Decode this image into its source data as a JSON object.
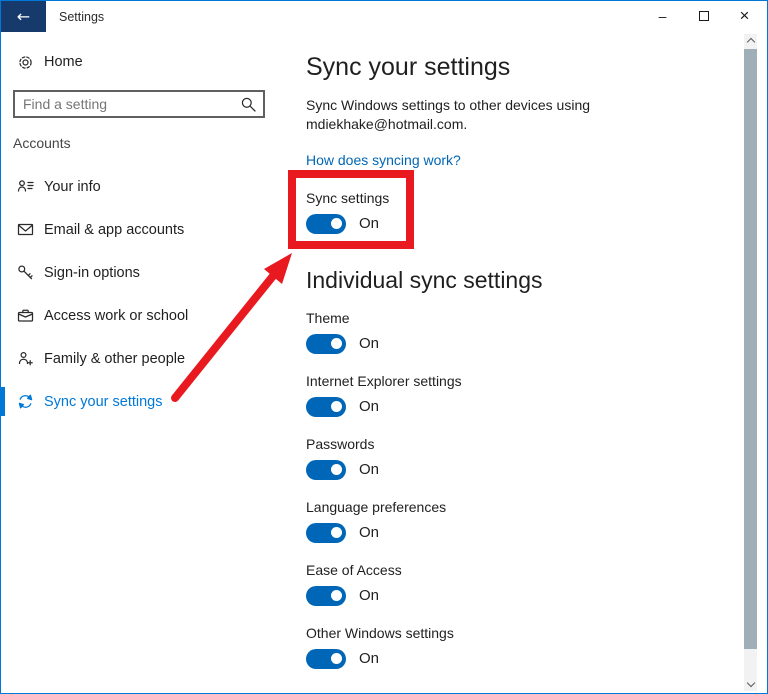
{
  "window": {
    "title": "Settings",
    "back_glyph": "←",
    "controls": {
      "minimize": "–",
      "close": "×"
    }
  },
  "sidebar": {
    "home": {
      "label": "Home",
      "icon": "gear-icon"
    },
    "search": {
      "placeholder": "Find a setting",
      "icon": "search-icon"
    },
    "section_label": "Accounts",
    "items": [
      {
        "label": "Your info",
        "icon": "person-card-icon",
        "selected": false
      },
      {
        "label": "Email & app accounts",
        "icon": "envelope-icon",
        "selected": false
      },
      {
        "label": "Sign-in options",
        "icon": "key-icon",
        "selected": false
      },
      {
        "label": "Access work or school",
        "icon": "briefcase-icon",
        "selected": false
      },
      {
        "label": "Family & other people",
        "icon": "person-add-icon",
        "selected": false
      },
      {
        "label": "Sync your settings",
        "icon": "sync-icon",
        "selected": true
      }
    ]
  },
  "main": {
    "title": "Sync your settings",
    "description_line1": "Sync Windows settings to other devices using",
    "description_line2": "mdiekhake@hotmail.com.",
    "link_label": "How does syncing work?",
    "master_toggle": {
      "label": "Sync settings",
      "state": "On"
    },
    "section_title": "Individual sync settings",
    "toggles": [
      {
        "label": "Theme",
        "state": "On"
      },
      {
        "label": "Internet Explorer settings",
        "state": "On"
      },
      {
        "label": "Passwords",
        "state": "On"
      },
      {
        "label": "Language preferences",
        "state": "On"
      },
      {
        "label": "Ease of Access",
        "state": "On"
      },
      {
        "label": "Other Windows settings",
        "state": "On"
      }
    ]
  },
  "annotations": {
    "highlight_box_color": "#e8191f",
    "arrow_color": "#e8191f"
  },
  "colors": {
    "accent": "#0078d7",
    "toggle_on": "#0067b8",
    "link": "#0066b4",
    "back_button_bg": "#173a6d"
  }
}
